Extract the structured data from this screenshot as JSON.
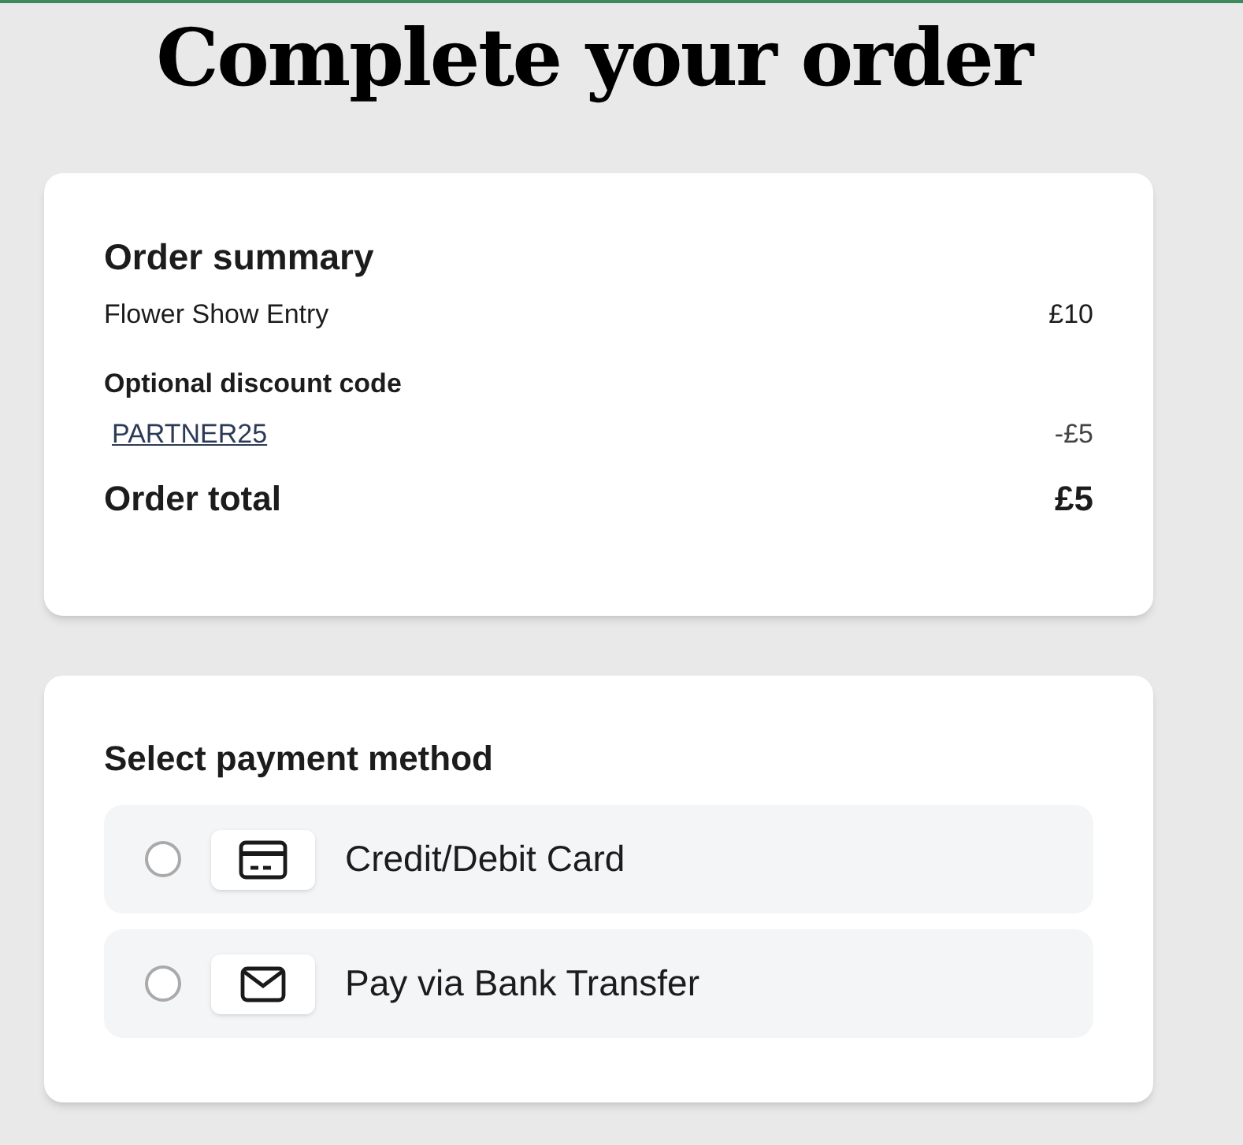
{
  "title": "Complete your order",
  "order_summary": {
    "heading": "Order summary",
    "items": [
      {
        "name": "Flower Show Entry",
        "price": "£10"
      }
    ],
    "discount": {
      "label": "Optional discount code",
      "code": "PARTNER25",
      "amount": "-£5"
    },
    "total": {
      "label": "Order total",
      "amount": "£5"
    }
  },
  "payment": {
    "heading": "Select payment method",
    "methods": [
      {
        "kind": "card",
        "label": "Credit/Debit Card",
        "selected": false
      },
      {
        "kind": "envelope",
        "label": "Pay via Bank Transfer",
        "selected": false
      }
    ]
  }
}
